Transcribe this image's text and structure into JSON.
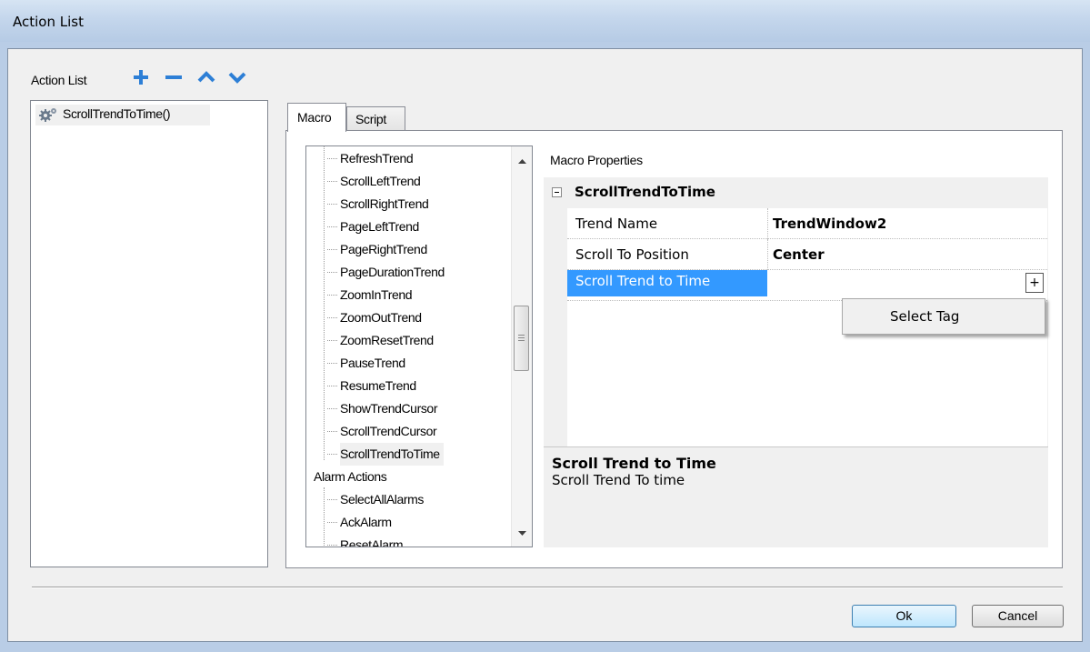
{
  "window": {
    "title": "Action List"
  },
  "toolbar": {
    "label": "Action List",
    "add_icon": "plus-icon",
    "remove_icon": "minus-icon",
    "up_icon": "chevron-up-icon",
    "down_icon": "chevron-down-icon",
    "accent": "#2d7fd6"
  },
  "actions": [
    {
      "label": "ScrollTrendToTime()",
      "icon": "gear-icon"
    }
  ],
  "tabs": [
    {
      "label": "Macro",
      "active": true
    },
    {
      "label": "Script",
      "active": false
    }
  ],
  "macro_tree": {
    "items": [
      "RefreshTrend",
      "ScrollLeftTrend",
      "ScrollRightTrend",
      "PageLeftTrend",
      "PageRightTrend",
      "PageDurationTrend",
      "ZoomInTrend",
      "ZoomOutTrend",
      "ZoomResetTrend",
      "PauseTrend",
      "ResumeTrend",
      "ShowTrendCursor",
      "ScrollTrendCursor",
      "ScrollTrendToTime"
    ],
    "selected": "ScrollTrendToTime",
    "group": "Alarm Actions",
    "group_items": [
      "SelectAllAlarms",
      "AckAlarm",
      "ResetAlarm"
    ]
  },
  "properties": {
    "header": "Macro Properties",
    "section": "ScrollTrendToTime",
    "rows": [
      {
        "name": "Trend Name",
        "value": "TrendWindow2"
      },
      {
        "name": "Scroll To Position",
        "value": "Center"
      },
      {
        "name": "Scroll Trend to Time",
        "value": ""
      }
    ],
    "selected_row_color": "#3399ff",
    "expand_button": "+",
    "dropdown_option": "Select Tag",
    "description_title": "Scroll Trend to Time",
    "description_text": "Scroll Trend To time"
  },
  "buttons": {
    "ok": "Ok",
    "cancel": "Cancel"
  }
}
